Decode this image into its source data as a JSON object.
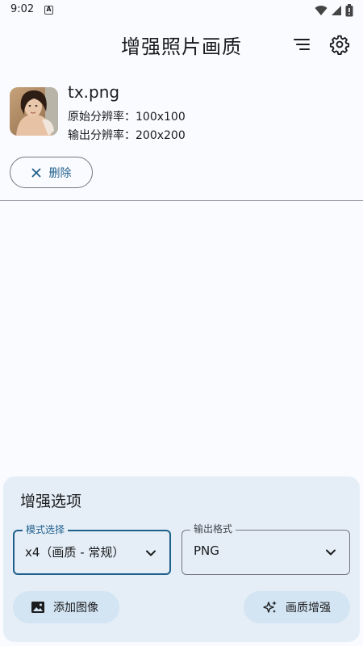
{
  "status_bar": {
    "time": "9:02",
    "notification_glyph": "A"
  },
  "app_bar": {
    "title": "增强照片画质",
    "icons": [
      "sort-icon",
      "settings-icon"
    ]
  },
  "file": {
    "name": "tx.png",
    "original_label": "原始分辨率：100x100",
    "output_label": "输出分辨率：200x200"
  },
  "delete_button": {
    "label": "删除",
    "icon": "close-icon"
  },
  "options_panel": {
    "title": "增强选项",
    "mode_field": {
      "label": "模式选择",
      "value": "x4（画质 - 常规）"
    },
    "format_field": {
      "label": "输出格式",
      "value": "PNG"
    },
    "add_image_button": "添加图像",
    "enhance_button": "画质增强"
  },
  "colors": {
    "accent": "#1f5f8b",
    "panel_bg": "#e5eef7",
    "tonal_button": "#d3e4f2",
    "background": "#fafbff"
  }
}
